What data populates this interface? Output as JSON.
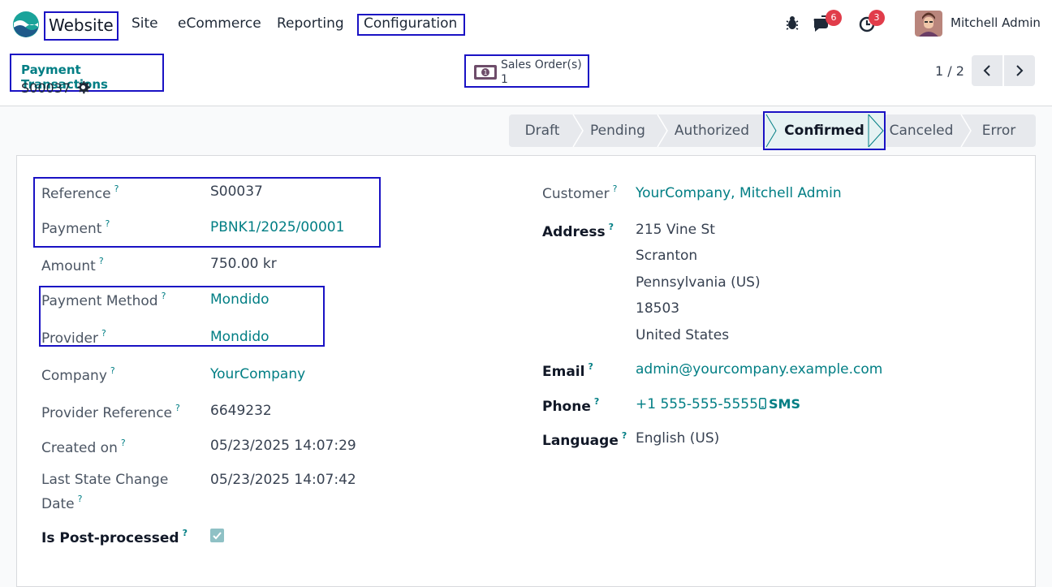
{
  "navbar": {
    "app_name": "Website",
    "menu": [
      "Site",
      "eCommerce",
      "Reporting",
      "Configuration"
    ],
    "messages_count": "6",
    "activities_count": "3",
    "user_name": "Mitchell Admin"
  },
  "control": {
    "breadcrumb_parent": "Payment Transactions",
    "breadcrumb_current": "S00037",
    "smart_button_label": "Sales Order(s)",
    "smart_button_value": "1",
    "pager": "1 / 2"
  },
  "statusbar": {
    "stages": [
      "Draft",
      "Pending",
      "Authorized",
      "Confirmed",
      "Canceled",
      "Error"
    ],
    "active": "Confirmed"
  },
  "form": {
    "left": [
      {
        "label": "Reference",
        "value": "S00037"
      },
      {
        "label": "Payment",
        "value": "PBNK1/2025/00001"
      },
      {
        "label": "Amount",
        "value": "750.00 kr"
      },
      {
        "label": "Payment Method",
        "value": "Mondido"
      },
      {
        "label": "Provider",
        "value": "Mondido"
      },
      {
        "label": "Company",
        "value": "YourCompany"
      },
      {
        "label": "Provider Reference",
        "value": "6649232"
      },
      {
        "label": "Created on",
        "value": "05/23/2025 14:07:29"
      },
      {
        "label_line1": "Last State Change",
        "label_line2": "Date",
        "value": "05/23/2025 14:07:42"
      },
      {
        "label": "Is Post-processed",
        "value": true
      }
    ],
    "right": {
      "customer_label": "Customer",
      "customer": "YourCompany, Mitchell Admin",
      "address_label": "Address",
      "address_lines": [
        "215 Vine St",
        "Scranton",
        "Pennsylvania (US)",
        "18503",
        "United States"
      ],
      "email_label": "Email",
      "email": "admin@yourcompany.example.com",
      "phone_label": "Phone",
      "phone": "+1 555-555-5555",
      "sms_label": "SMS",
      "language_label": "Language",
      "language": "English (US)"
    },
    "help_mark": "?"
  },
  "colors": {
    "accent": "#017e84",
    "highlight_box": "#1a12c4",
    "badge": "#e13c4a"
  }
}
